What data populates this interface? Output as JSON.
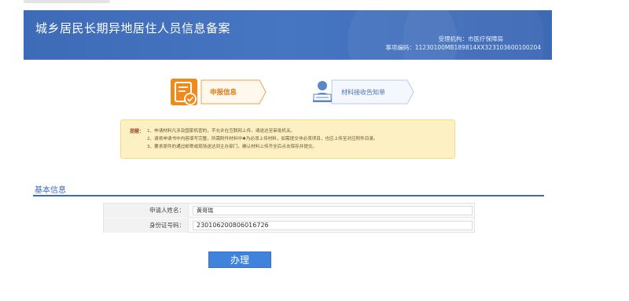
{
  "header": {
    "title": "城乡居民长期异地居住人员信息备案",
    "agency": "受理机构：市医疗保障局",
    "code": "事项编码：11230100MB189814XX323103600100204"
  },
  "steps": {
    "step1_label": "申报信息",
    "step2_label": "材料接收告知单"
  },
  "notice": {
    "label": "提醒：",
    "lines": [
      "1、申请材料凡涉及国家机密的，不允许在互联网上传，请送达至审批机关。",
      "2、请将申请书中内容填写完整，所需附件材料中✱为必须上传材料，如需提交非必须项目，也应上传至对应附件目录。",
      "3、要求原件的通过邮寄或现场送达到主办部门，确认材料上传齐全后点击保存并提交。"
    ]
  },
  "basic_info": {
    "section_title": "基本信息",
    "name_label": "申请人姓名：",
    "name_value": "黄哥瑞",
    "id_label": "身份证号码：",
    "id_value": "230106200806016726"
  },
  "actions": {
    "submit_label": "办理"
  },
  "colors": {
    "banner": "#4170bd",
    "accent_orange": "#f08a1c",
    "accent_blue": "#3b6bb5",
    "notice_bg": "#fdf0c2",
    "button": "#3f83dc"
  }
}
